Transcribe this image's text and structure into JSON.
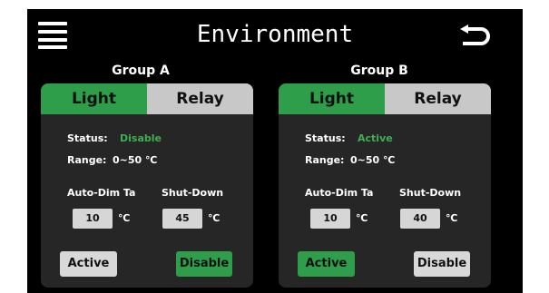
{
  "header": {
    "title": "Environment"
  },
  "groups": [
    {
      "title": "Group A",
      "tabs": [
        "Light",
        "Relay"
      ],
      "status_label": "Status:",
      "status_value": "Disable",
      "range_label": "Range:",
      "range_value": "0~50 ℃",
      "autodim_label": "Auto-Dim Ta",
      "autodim_value": "10",
      "shutdown_label": "Shut-Down",
      "shutdown_value": "45",
      "unit": "℃",
      "active_label": "Active",
      "disable_label": "Disable"
    },
    {
      "title": "Group B",
      "tabs": [
        "Light",
        "Relay"
      ],
      "status_label": "Status:",
      "status_value": "Active",
      "range_label": "Range:",
      "range_value": "0~50 ℃",
      "autodim_label": "Auto-Dim Ta",
      "autodim_value": "10",
      "shutdown_label": "Shut-Down",
      "shutdown_value": "40",
      "unit": "℃",
      "active_label": "Active",
      "disable_label": "Disable"
    }
  ],
  "colors": {
    "accent_green": "#2e9e4a",
    "status_green": "#3fae55",
    "inactive_grey": "#c8c8c8",
    "panel_bg": "#262626"
  },
  "icons": {
    "menu": "menu-icon",
    "back": "back-icon"
  }
}
